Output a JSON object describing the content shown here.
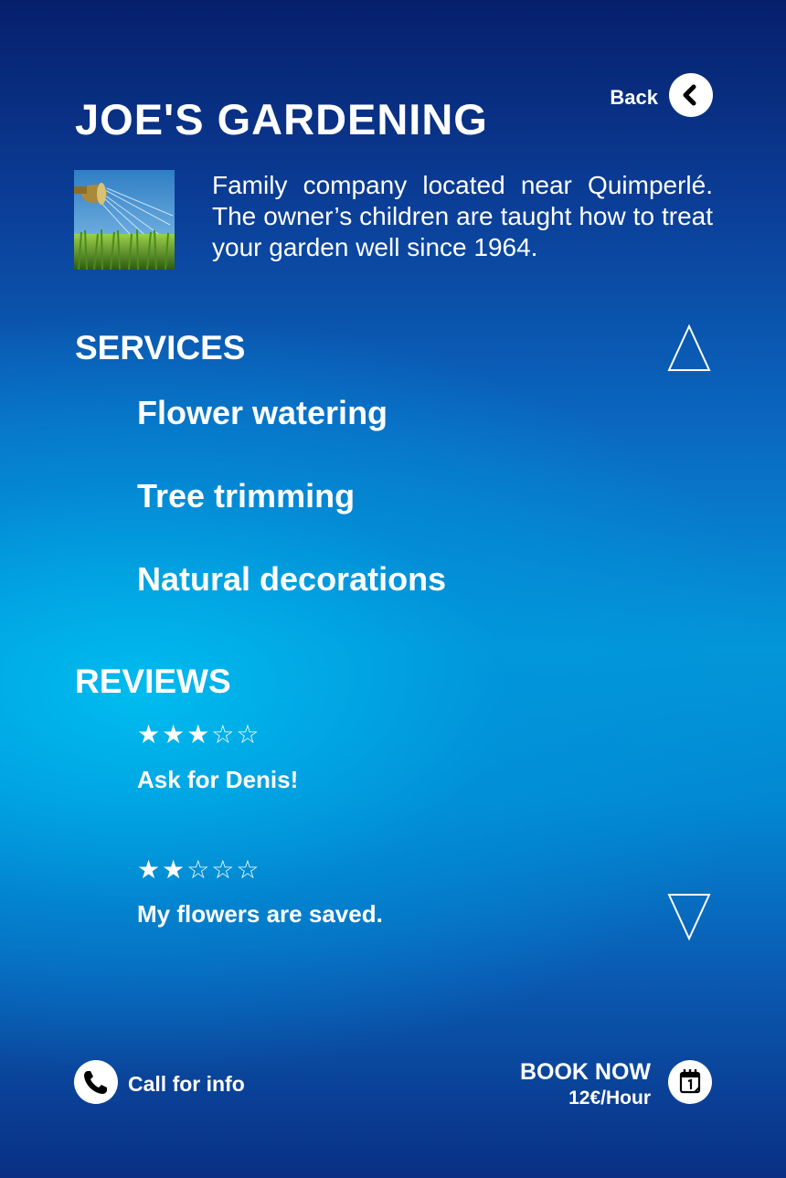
{
  "header": {
    "title": "JOE'S GARDENING",
    "back_label": "Back"
  },
  "intro": {
    "description": "Family company located near Quimperlé. The owner’s children are taught how to treat your garden well since 1964."
  },
  "services": {
    "heading": "SERVICES",
    "items": [
      "Flower watering",
      "Tree trimming",
      "Natural decorations"
    ]
  },
  "reviews": {
    "heading": "REVIEWS",
    "items": [
      {
        "rating": 3,
        "max": 5,
        "stars": "★★★☆☆",
        "text": "Ask for Denis!"
      },
      {
        "rating": 2,
        "max": 5,
        "stars": "★★☆☆☆",
        "text": "My flowers are saved."
      }
    ]
  },
  "footer": {
    "call_label": "Call for info",
    "book_label": "BOOK NOW",
    "price": "12€/Hour"
  },
  "icons": {
    "back": "chevron-left-icon",
    "scroll_up": "triangle-up-icon",
    "scroll_down": "triangle-down-icon",
    "call": "phone-icon",
    "book": "calendar-icon"
  },
  "colors": {
    "text": "#ffffff",
    "button_bg": "#ffffff",
    "icon": "#000000",
    "background_top": "#061f6b",
    "background_mid": "#0396d8"
  }
}
